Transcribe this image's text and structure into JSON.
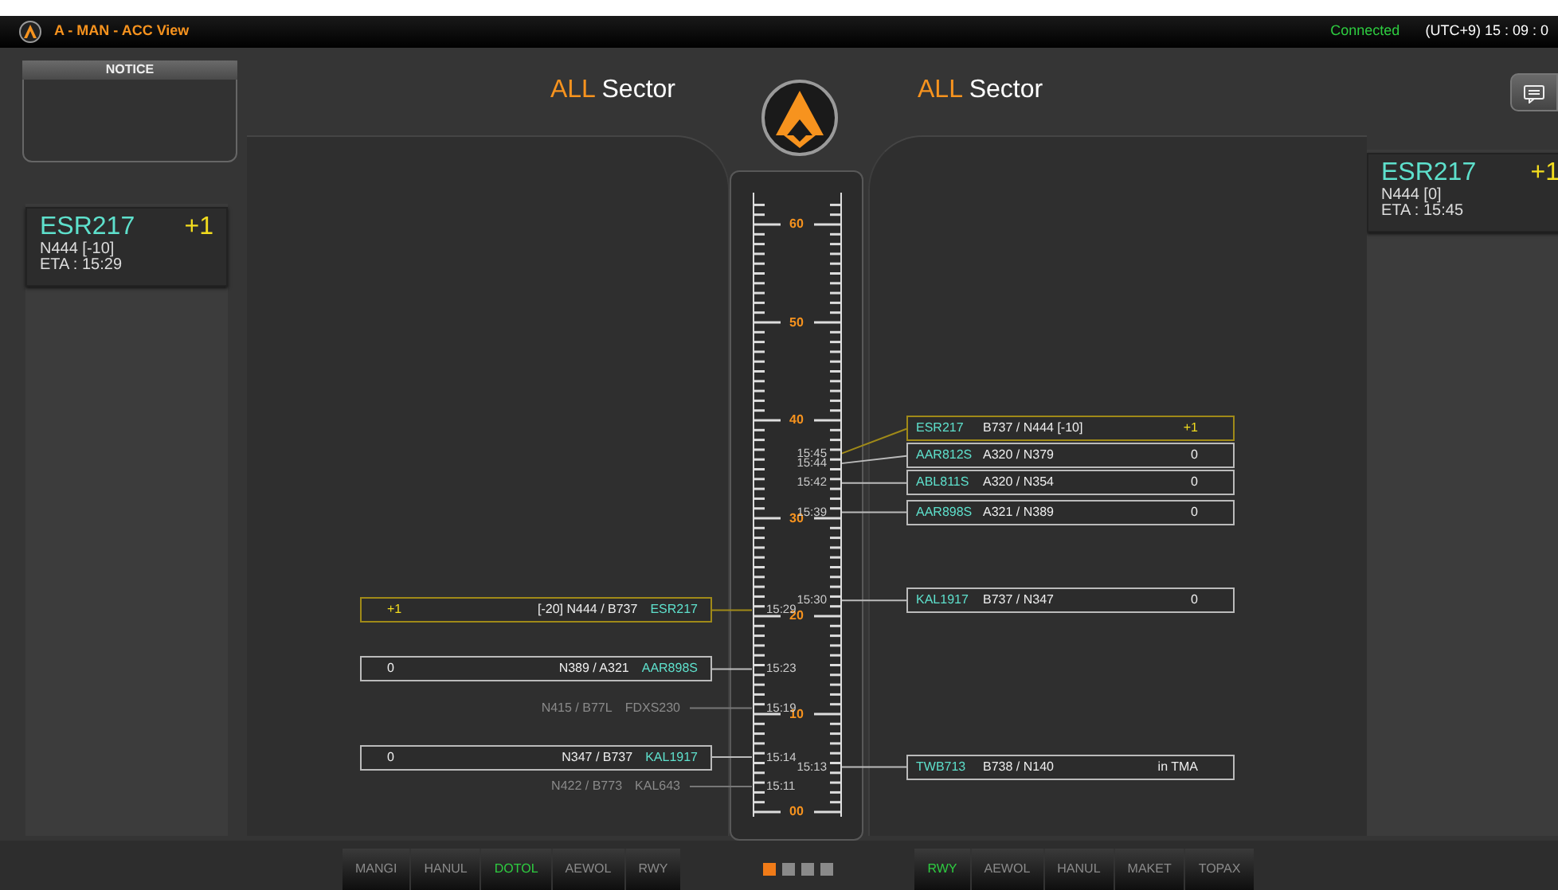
{
  "title_bar": {
    "title": "A - MAN - ACC View",
    "status": "Connected",
    "clock": "(UTC+9) 15 : 09 : 0"
  },
  "notice": {
    "label": "NOTICE"
  },
  "sectors": [
    {
      "highlight": "ALL",
      "label": "Sector"
    },
    {
      "highlight": "ALL",
      "label": "Sector"
    }
  ],
  "side_cards": [
    {
      "callsign": "ESR217",
      "count": "+1",
      "route": "N444 [-10]",
      "eta": "ETA : 15:29"
    },
    {
      "callsign": "ESR217",
      "count": "+1",
      "route": "N444 [0]",
      "eta": "ETA : 15:45"
    }
  ],
  "ruler": {
    "labels": [
      "60",
      "50",
      "40",
      "30",
      "20",
      "10",
      "00"
    ]
  },
  "left_strips": [
    {
      "kind": "highlighted",
      "note": "+1",
      "route": "[-20] N444 / B737",
      "callsign": "ESR217",
      "time": "15:29"
    },
    {
      "kind": "normal",
      "note": "0",
      "route": "N389 / A321",
      "callsign": "AAR898S",
      "time": "15:23"
    },
    {
      "kind": "dim",
      "route": "N415 / B77L",
      "callsign": "FDXS230",
      "time": "15:19"
    },
    {
      "kind": "normal",
      "note": "0",
      "route": "N347 / B737",
      "callsign": "KAL1917",
      "time": "15:14"
    },
    {
      "kind": "dim",
      "route": "N422 / B773",
      "callsign": "KAL643",
      "time": "15:11"
    }
  ],
  "right_strips": [
    {
      "kind": "highlighted",
      "callsign": "ESR217",
      "route": "B737 / N444 [-10]",
      "note": "+1",
      "time": "15:45"
    },
    {
      "kind": "normal",
      "callsign": "AAR812S",
      "route": "A320 / N379",
      "note": "0",
      "time": "15:44"
    },
    {
      "kind": "normal",
      "callsign": "ABL811S",
      "route": "A320 / N354",
      "note": "0",
      "time": "15:42"
    },
    {
      "kind": "normal",
      "callsign": "AAR898S",
      "route": "A321 / N389",
      "note": "0",
      "time": "15:39"
    },
    {
      "kind": "normal",
      "callsign": "KAL1917",
      "route": "B737 / N347",
      "note": "0",
      "time": "15:30"
    },
    {
      "kind": "normal",
      "callsign": "TWB713",
      "route": "B738 / N140",
      "note": "in TMA",
      "time": "15:13"
    }
  ],
  "bottom": {
    "left_tabs": [
      {
        "label": "MANGI",
        "selected": false
      },
      {
        "label": "HANUL",
        "selected": false
      },
      {
        "label": "DOTOL",
        "selected": true
      },
      {
        "label": "AEWOL",
        "selected": false
      },
      {
        "label": "RWY",
        "selected": false
      }
    ],
    "page_dots": [
      {
        "selected": true
      },
      {
        "selected": false
      },
      {
        "selected": false
      },
      {
        "selected": false
      }
    ],
    "right_tabs": [
      {
        "label": "RWY",
        "selected": true
      },
      {
        "label": "AEWOL",
        "selected": false
      },
      {
        "label": "HANUL",
        "selected": false
      },
      {
        "label": "MAKET",
        "selected": false
      },
      {
        "label": "TOPAX",
        "selected": false
      }
    ]
  }
}
